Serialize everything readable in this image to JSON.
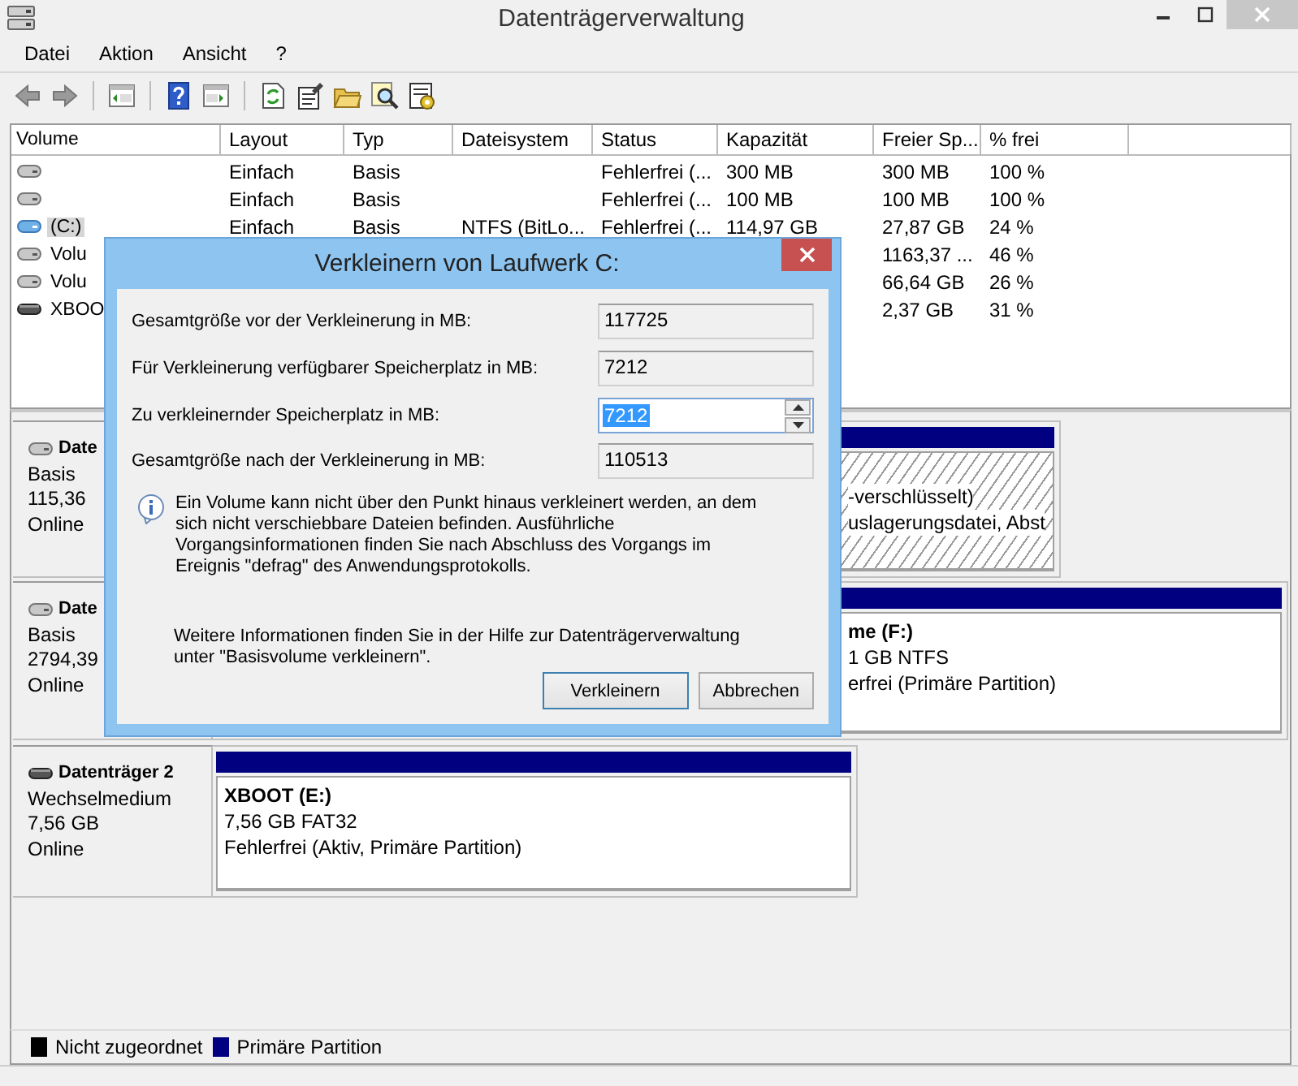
{
  "window": {
    "title": "Datenträgerverwaltung"
  },
  "menu": [
    "Datei",
    "Aktion",
    "Ansicht",
    "?"
  ],
  "table": {
    "columns": [
      "Volume",
      "Layout",
      "Typ",
      "Dateisystem",
      "Status",
      "Kapazität",
      "Freier Sp...",
      "% frei"
    ],
    "rows": [
      {
        "kind": "hdd",
        "selected": false,
        "cells": [
          "",
          "Einfach",
          "Basis",
          "",
          "Fehlerfrei (...",
          "300 MB",
          "300 MB",
          "100 %"
        ]
      },
      {
        "kind": "hdd",
        "selected": false,
        "cells": [
          "",
          "Einfach",
          "Basis",
          "",
          "Fehlerfrei (...",
          "100 MB",
          "100 MB",
          "100 %"
        ]
      },
      {
        "kind": "system",
        "selected": true,
        "cells": [
          "(C:)",
          "Einfach",
          "Basis",
          "NTFS (BitLo...",
          "Fehlerfrei (...",
          "114,97 GB",
          "27,87 GB",
          "24 %"
        ]
      },
      {
        "kind": "hdd",
        "selected": false,
        "cells": [
          "Volu",
          "",
          "",
          "",
          "",
          "",
          "1163,37 ...",
          "46 %"
        ]
      },
      {
        "kind": "hdd",
        "selected": false,
        "cells": [
          "Volu",
          "",
          "",
          "",
          "",
          "",
          "66,64 GB",
          "26 %"
        ]
      },
      {
        "kind": "removable",
        "selected": false,
        "cells": [
          "XBOO",
          "",
          "",
          "",
          "",
          "",
          "2,37 GB",
          "31 %"
        ]
      }
    ]
  },
  "disks": [
    {
      "kind": "hdd",
      "name": "Date",
      "lines": [
        "Basis",
        "115,36",
        "Online"
      ],
      "partitions": [
        {
          "hatched": true,
          "lines": [
            "-verschlüsselt)",
            "uslagerungsdatei, Abst"
          ]
        }
      ]
    },
    {
      "kind": "hdd",
      "name": "Date",
      "lines": [
        "Basis",
        "2794,39",
        "Online"
      ],
      "partitions": [
        {
          "hatched": false,
          "title": "me  (F:)",
          "lines": [
            "1 GB NTFS",
            "erfrei (Primäre Partition)"
          ]
        }
      ]
    },
    {
      "kind": "removable",
      "name": "Datenträger 2",
      "lines": [
        "Wechselmedium",
        "7,56 GB",
        "Online"
      ],
      "partitions": [
        {
          "hatched": false,
          "title": "XBOOT  (E:)",
          "lines": [
            "7,56 GB FAT32",
            "Fehlerfrei (Aktiv, Primäre Partition)"
          ]
        }
      ]
    }
  ],
  "legend": [
    {
      "label": "Nicht zugeordnet",
      "color": "#000000"
    },
    {
      "label": "Primäre Partition",
      "color": "#000080"
    }
  ],
  "dialog": {
    "title": "Verkleinern von Laufwerk C:",
    "fields": [
      {
        "label": "Gesamtgröße vor der Verkleinerung in MB:",
        "value": "117725",
        "kind": "readonly",
        "text_selected": false
      },
      {
        "label": "Für Verkleinerung verfügbarer Speicherplatz in MB:",
        "value": "7212",
        "kind": "readonly",
        "text_selected": false
      },
      {
        "label": "Zu verkleinernder Speicherplatz in MB:",
        "value": "7212",
        "kind": "spinner",
        "text_selected": true
      },
      {
        "label": "Gesamtgröße nach der Verkleinerung in MB:",
        "value": "110513",
        "kind": "readonly",
        "text_selected": false
      }
    ],
    "info": "Ein Volume kann nicht über den Punkt hinaus verkleinert werden, an dem sich nicht verschiebbare Dateien befinden. Ausführliche Vorgangsinformationen finden Sie nach Abschluss des Vorgangs im Ereignis \"defrag\" des Anwendungsprotokolls.",
    "help": "Weitere Informationen finden Sie in der Hilfe zur Datenträgerverwaltung unter \"Basisvolume verkleinern\".",
    "buttons": [
      {
        "label": "Verkleinern",
        "default": true
      },
      {
        "label": "Abbrechen",
        "default": false
      }
    ]
  }
}
